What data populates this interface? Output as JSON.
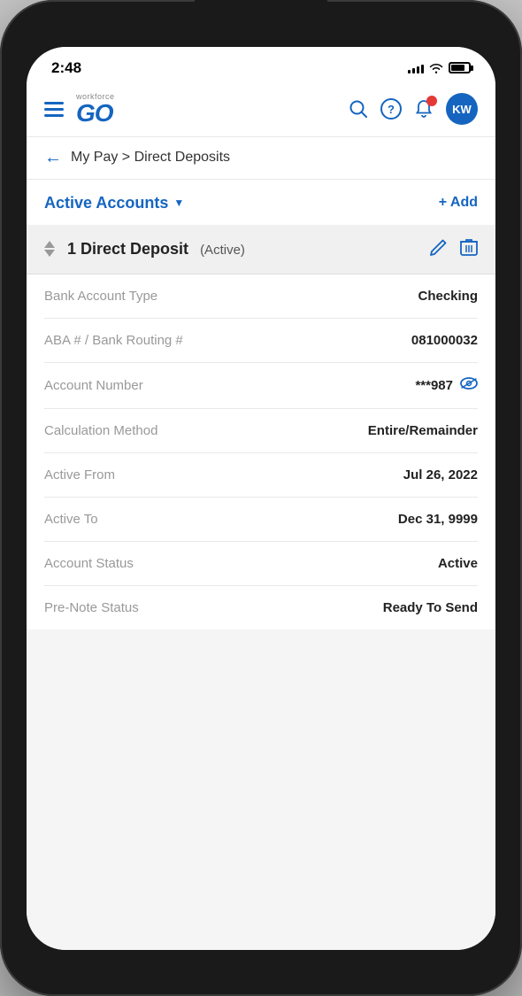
{
  "statusBar": {
    "time": "2:48",
    "signalBars": [
      3,
      5,
      7,
      10,
      12
    ],
    "batteryLevel": 80
  },
  "topNav": {
    "logoWorkforce": "workforce",
    "logoGo": "GO",
    "avatarInitials": "KW"
  },
  "breadcrumb": {
    "text": "My Pay > Direct Deposits"
  },
  "accountsSection": {
    "title": "Active Accounts",
    "addLabel": "+ Add"
  },
  "depositCard": {
    "title": "1 Direct Deposit",
    "badge": "(Active)"
  },
  "detailRows": [
    {
      "label": "Bank Account Type",
      "value": "Checking",
      "hasEye": false
    },
    {
      "label": "ABA # / Bank Routing #",
      "value": "081000032",
      "hasEye": false
    },
    {
      "label": "Account Number",
      "value": "***987",
      "hasEye": true
    },
    {
      "label": "Calculation Method",
      "value": "Entire/Remainder",
      "hasEye": false
    },
    {
      "label": "Active From",
      "value": "Jul 26, 2022",
      "hasEye": false
    },
    {
      "label": "Active To",
      "value": "Dec 31, 9999",
      "hasEye": false
    },
    {
      "label": "Account Status",
      "value": "Active",
      "hasEye": false
    },
    {
      "label": "Pre-Note Status",
      "value": "Ready To Send",
      "hasEye": false
    }
  ]
}
